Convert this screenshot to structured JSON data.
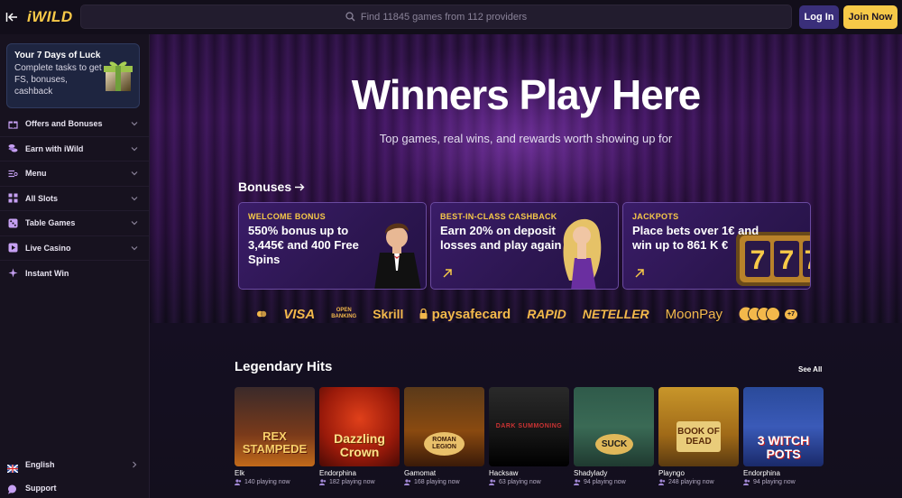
{
  "header": {
    "logo": "iWILD",
    "search_placeholder": "Find 11845 games from 112 providers",
    "login_label": "Log In",
    "join_label": "Join Now"
  },
  "sidebar": {
    "luck_card": {
      "title": "Your 7 Days of Luck",
      "text": "Complete tasks to get FS, bonuses, cashback"
    },
    "items": [
      {
        "label": "Offers and Bonuses",
        "icon": "gift-icon"
      },
      {
        "label": "Earn with iWild",
        "icon": "coins-icon"
      },
      {
        "label": "Menu",
        "icon": "menu-icon"
      },
      {
        "label": "All Slots",
        "icon": "grid-icon"
      },
      {
        "label": "Table Games",
        "icon": "dice-icon"
      },
      {
        "label": "Live Casino",
        "icon": "play-icon"
      },
      {
        "label": "Instant Win",
        "icon": "star-icon"
      }
    ],
    "language": "English",
    "support": "Support"
  },
  "hero": {
    "title": "Winners Play Here",
    "subtitle": "Top games, real wins, and rewards worth showing up for"
  },
  "bonuses": {
    "title": "Bonuses",
    "cards": [
      {
        "tag": "WELCOME BONUS",
        "text": "550% bonus up to 3,445€ and 400 Free Spins"
      },
      {
        "tag": "BEST-IN-CLASS CASHBACK",
        "text": "Earn 20% on deposit losses and play again"
      },
      {
        "tag": "JACKPOTS",
        "text": "Place bets over 1€ and win up to 861 K €"
      }
    ]
  },
  "payments": [
    "VISA",
    "OPEN BANKING",
    "Skrill",
    "paysafecard",
    "RAPID",
    "NETELLER",
    "MoonPay",
    "+7"
  ],
  "legendary": {
    "title": "Legendary Hits",
    "see_all": "See All",
    "games": [
      {
        "art_text": "REX STAMPEDE",
        "provider": "Elk",
        "players": "140 playing now"
      },
      {
        "art_text": "Dazzling Crown",
        "provider": "Endorphina",
        "players": "182 playing now"
      },
      {
        "art_text": "ROMAN LEGION",
        "provider": "Gamomat",
        "players": "168 playing now"
      },
      {
        "art_text": "DARK SUMMONING",
        "provider": "Hacksaw",
        "players": "63 playing now"
      },
      {
        "art_text": "SUCK",
        "provider": "Shadylady",
        "players": "94 playing now"
      },
      {
        "art_text": "BOOK OF DEAD",
        "provider": "Playngo",
        "players": "248 playing now"
      },
      {
        "art_text": "3 WITCH POTS",
        "provider": "Endorphina",
        "players": "94 playing now"
      }
    ]
  },
  "colors": {
    "accent_gold": "#f7c948",
    "login_purple": "#3a2f7a",
    "card_border": "#6a4aa0"
  }
}
